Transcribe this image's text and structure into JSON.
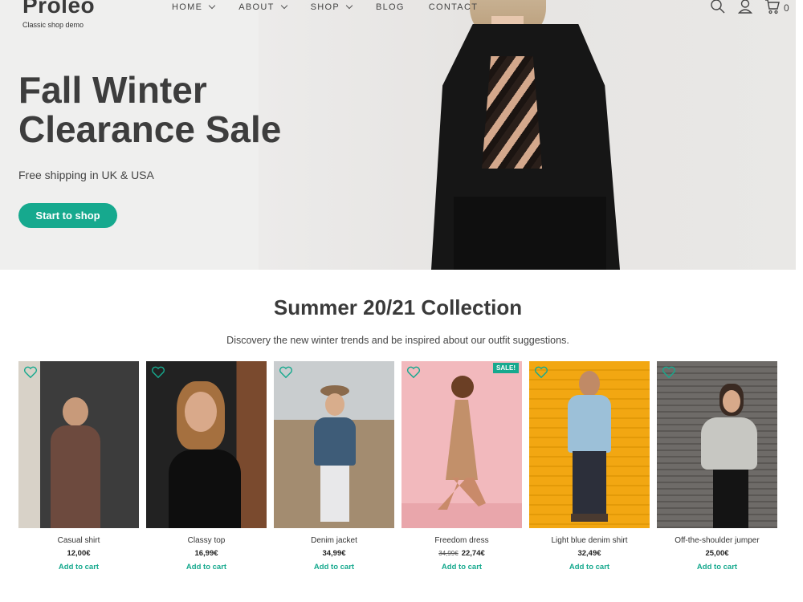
{
  "brand": {
    "name": "Proleo",
    "tagline": "Classic shop demo"
  },
  "nav": [
    {
      "label": "HOME",
      "dropdown": true
    },
    {
      "label": "ABOUT",
      "dropdown": true
    },
    {
      "label": "SHOP",
      "dropdown": true
    },
    {
      "label": "BLOG",
      "dropdown": false
    },
    {
      "label": "CONTACT",
      "dropdown": false
    }
  ],
  "header_icons": {
    "search": "search-icon",
    "account": "user-icon",
    "cart": "cart-icon",
    "cart_count": "0"
  },
  "hero": {
    "title_line1": "Fall Winter",
    "title_line2": "Clearance Sale",
    "subtitle": "Free shipping in UK & USA",
    "button": "Start to shop"
  },
  "collection": {
    "title": "Summer 20/21 Collection",
    "subtitle": "Discovery the new winter trends and be inspired about our outfit suggestions."
  },
  "products": [
    {
      "name": "Casual shirt",
      "price": "12,00€",
      "old_price": "",
      "sale": "",
      "add": "Add to cart"
    },
    {
      "name": "Classy top",
      "price": "16,99€",
      "old_price": "",
      "sale": "",
      "add": "Add to cart"
    },
    {
      "name": "Denim jacket",
      "price": "34,99€",
      "old_price": "",
      "sale": "",
      "add": "Add to cart"
    },
    {
      "name": "Freedom dress",
      "price": "22,74€",
      "old_price": "34,99€",
      "sale": "SALE!",
      "add": "Add to cart"
    },
    {
      "name": "Light blue denim shirt",
      "price": "32,49€",
      "old_price": "",
      "sale": "",
      "add": "Add to cart"
    },
    {
      "name": "Off-the-shoulder jumper",
      "price": "25,00€",
      "old_price": "",
      "sale": "",
      "add": "Add to cart"
    }
  ],
  "colors": {
    "accent": "#16a98e",
    "heading": "#3d3d3d",
    "hero_bg": "#efefee"
  }
}
